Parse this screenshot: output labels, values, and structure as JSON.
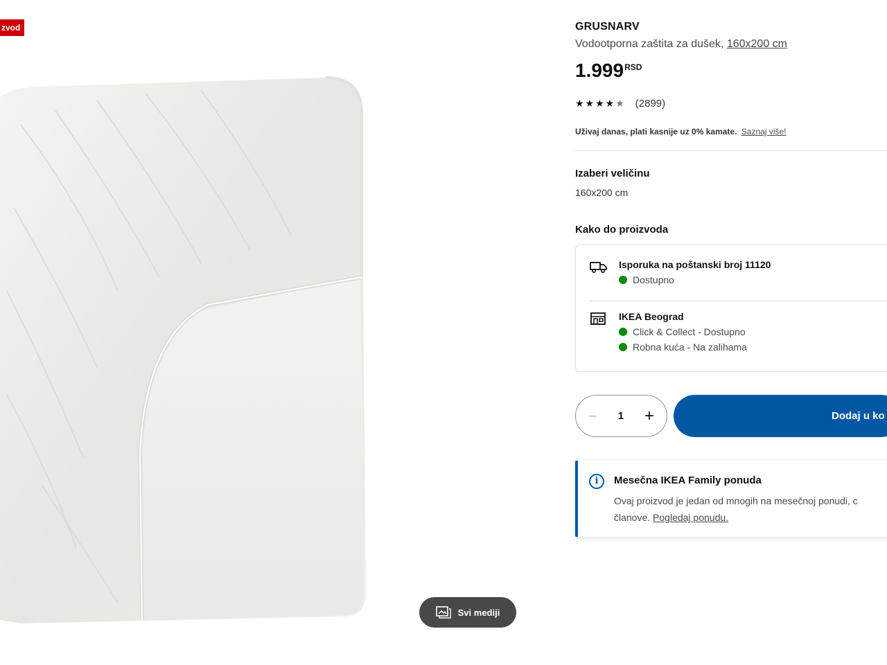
{
  "media": {
    "badge_label": "zvod",
    "all_media_label": "Svi mediji"
  },
  "product": {
    "brand": "GRUSNARV",
    "description": "Vodootporna zaštita za dušek,",
    "size_link": "160x200 cm",
    "price_value": "1.999",
    "price_currency": "RSD",
    "rating_stars": 4.5,
    "rating_count": "(2899)",
    "finance_text": "Uživaj danas, plati kasnije uz 0% kamate.",
    "finance_link": "Saznaj više!"
  },
  "size_selector": {
    "heading": "Izaberi veličinu",
    "value": "160x200 cm"
  },
  "availability": {
    "heading": "Kako do proizvoda",
    "delivery": {
      "title": "Isporuka na poštanski broj 11120",
      "status": "Dostupno"
    },
    "store": {
      "title": "IKEA Beograd",
      "status_1": "Click & Collect - Dostupno",
      "status_2": "Robna kuća - Na zalihama"
    },
    "status_color": "#0a8a00"
  },
  "purchase": {
    "quantity": "1",
    "add_to_cart_label": "Dodaj u ko"
  },
  "offer": {
    "title": "Mesečna IKEA Family ponuda",
    "text_line1": "Ovaj proizvod je jedan od mnogih na mesečnoj ponudi, c",
    "text_line2": "članove.",
    "link": "Pogledaj ponudu."
  },
  "colors": {
    "primary_blue": "#0058a3",
    "badge_red": "#cc0008"
  }
}
